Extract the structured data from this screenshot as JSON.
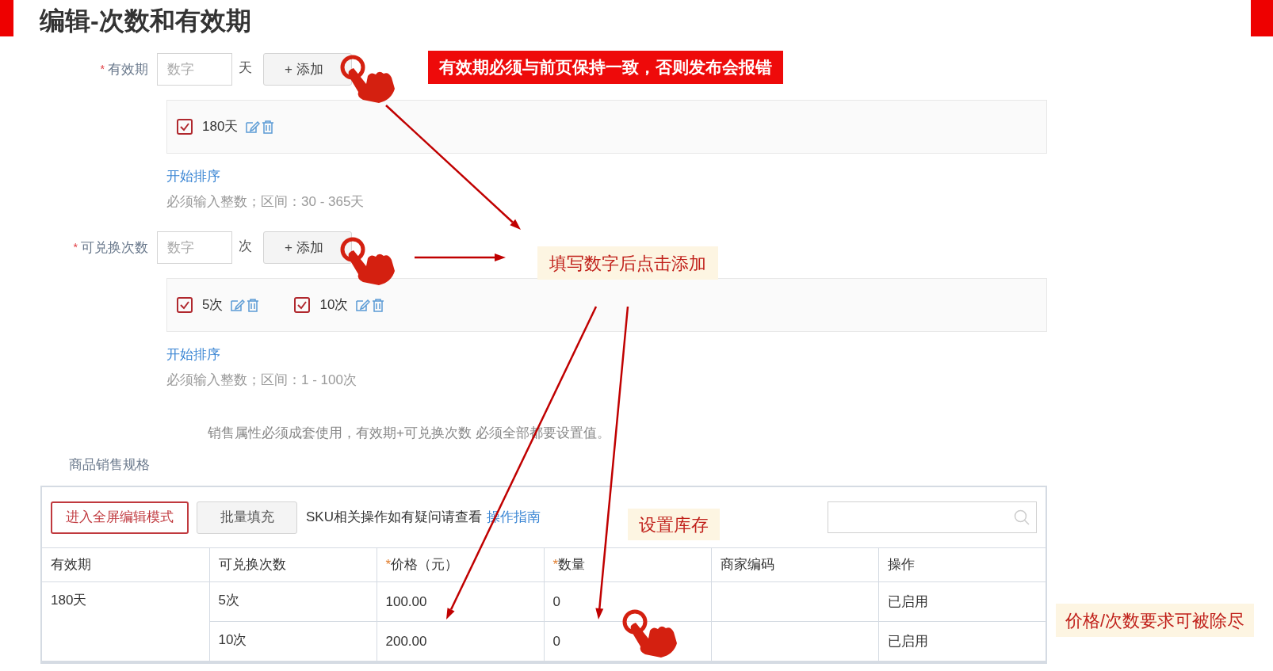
{
  "title": "编辑-次数和有效期",
  "attributes": [
    {
      "label": "有效期",
      "marker": "*",
      "placeholder": "数字",
      "unit": "天",
      "add_button": "+ 添加",
      "values": [
        {
          "label": "180天",
          "checked": true
        }
      ],
      "sort_link": "开始排序",
      "hint": "必须输入整数；区间：30 - 365天"
    },
    {
      "label": "可兑换次数",
      "marker": "*",
      "placeholder": "数字",
      "unit": "次",
      "add_button": "+ 添加",
      "values": [
        {
          "label": "5次",
          "checked": true
        },
        {
          "label": "10次",
          "checked": true
        }
      ],
      "sort_link": "开始排序",
      "hint": "必须输入整数；区间：1 - 100次"
    }
  ],
  "notice": "销售属性必须成套使用，有效期+可兑换次数 必须全部都要设置值。",
  "section_label": "商品销售规格",
  "toolbar": {
    "fullscreen_button": "进入全屏编辑模式",
    "batch_button": "批量填充",
    "help_text": "SKU相关操作如有疑问请查看",
    "help_link": "操作指南"
  },
  "table": {
    "columns": [
      {
        "label": "有效期"
      },
      {
        "label": "可兑换次数"
      },
      {
        "label": "价格（元）",
        "marker": "*"
      },
      {
        "label": "数量",
        "marker": "*"
      },
      {
        "label": "商家编码"
      },
      {
        "label": "操作"
      }
    ],
    "groups": [
      {
        "validity": "180天",
        "rows": [
          {
            "count": "5次",
            "price": "100.00",
            "quantity": "0",
            "status": "已启用"
          },
          {
            "count": "10次",
            "price": "200.00",
            "quantity": "0",
            "status": "已启用"
          }
        ]
      }
    ]
  },
  "annotations": [
    {
      "text": "有效期必须与前页保持一致，否则发布会报错",
      "kind": "banner"
    },
    {
      "text": "填写数字后点击添加",
      "kind": "note"
    },
    {
      "text": "设置库存",
      "kind": "note"
    },
    {
      "text": "价格/次数要求可被除尽",
      "kind": "note"
    }
  ]
}
